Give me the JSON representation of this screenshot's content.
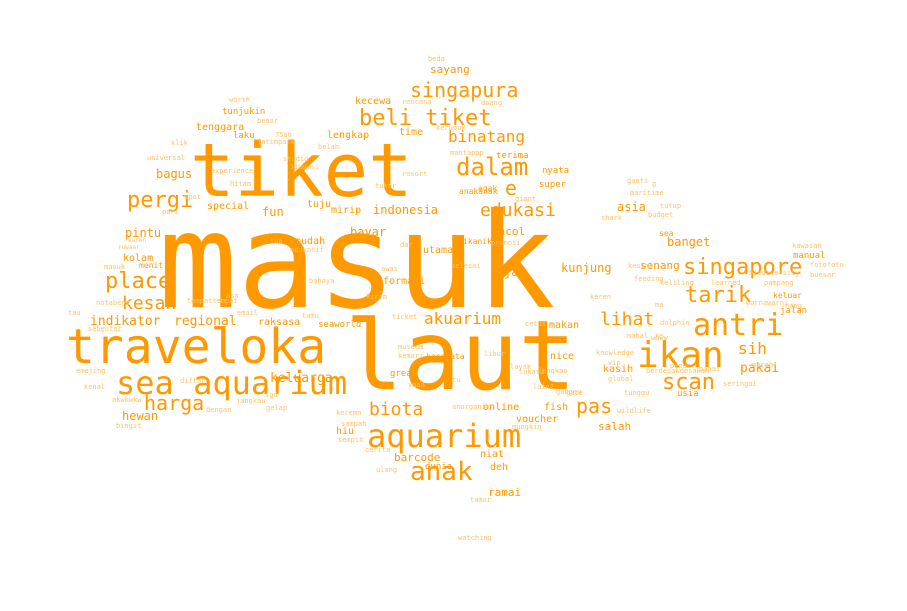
{
  "colors": {
    "background": "#ffffff",
    "primary": "#ff9900",
    "light": "#ffc266"
  },
  "words": [
    "masuk",
    "laut",
    "tiket",
    "traveloka",
    "sea aquarium",
    "aquarium",
    "anak",
    "antri",
    "ikan",
    "singapore",
    "beli tiket",
    "singapura",
    "dalam",
    "binatang",
    "edukasi",
    "tarik",
    "scan",
    "pergi",
    "place",
    "kesan",
    "harga",
    "biota",
    "akuarium",
    "lihat",
    "pas",
    "sih",
    "e",
    "pakai",
    "indikator",
    "regional",
    "keluarga",
    "bagus",
    "pintu",
    "hewan",
    "indonesia",
    "fun",
    "banget",
    "asia",
    "senang",
    "jam",
    "kunjung",
    "bayar",
    "ancol",
    "sayang",
    "kecewa",
    "lengkap",
    "time",
    "tuju",
    "mirip",
    "special",
    "ramai",
    "barcode",
    "deh",
    "niat",
    "hiu",
    "salah",
    "voucher",
    "online",
    "fish",
    "nice",
    "kasih",
    "makan",
    "raksasa",
    "seaworld",
    "informasi",
    "utama",
    "mudah",
    "tua",
    "kolam",
    "menit",
    "tenggara",
    "tunjukin",
    "laku",
    "sea",
    "jalan",
    "keluar",
    "manual",
    "usia",
    "dunia",
    "great",
    "kacamata",
    "museum",
    "terima",
    "nyata",
    "super",
    "agak",
    "anakanak",
    "ikanikan",
    "worth",
    "benar",
    "klik",
    "jatimpark",
    "universal",
    "experience",
    "hitam",
    "pari",
    "spot",
    "ruwaar",
    "karen",
    "masuk",
    "studio",
    "3dimensi",
    "belah",
    "mantappp",
    "resort",
    "tukar",
    "giant",
    "ganti",
    "maritime",
    "budget",
    "tutup",
    "shark",
    "learned",
    "keliling",
    "feeding",
    "biodiversity",
    "kawasan",
    "pampang",
    "fotofoto",
    "buesar",
    "neng",
    "dolphin",
    "mahal",
    "knowledge",
    "vip",
    "tunggu",
    "gate",
    "wildlife",
    "global",
    "seringai",
    "penuh",
    "berdesakdesakan",
    "lengkao",
    "layak",
    "ganggu",
    "libur",
    "mungkin",
    "cerita",
    "sempit",
    "sampah",
    "keremn",
    "ulang",
    "tamar",
    "watching",
    "beda",
    "doang",
    "rencana",
    "kenal",
    "emejing",
    "akwkwkw",
    "bingit",
    "dengan",
    "jangkau",
    "gelap",
    "sgd",
    "email",
    "tamu",
    "kemari",
    "yaaa",
    "tu",
    "anorganik",
    "bahaya",
    "edukatif",
    "promosi",
    "cetus",
    "ticket",
    "lokasi",
    "lain2",
    "75an",
    "kerupuk",
    "tempattempat",
    "asa",
    "tau",
    "notabene",
    "sebentar",
    "diftar",
    "panas",
    "murah",
    "warnawarni",
    "keren",
    "kesini",
    "woww",
    "dar",
    "awas",
    "selesai",
    "kirim",
    "ma",
    "ke",
    "g"
  ]
}
